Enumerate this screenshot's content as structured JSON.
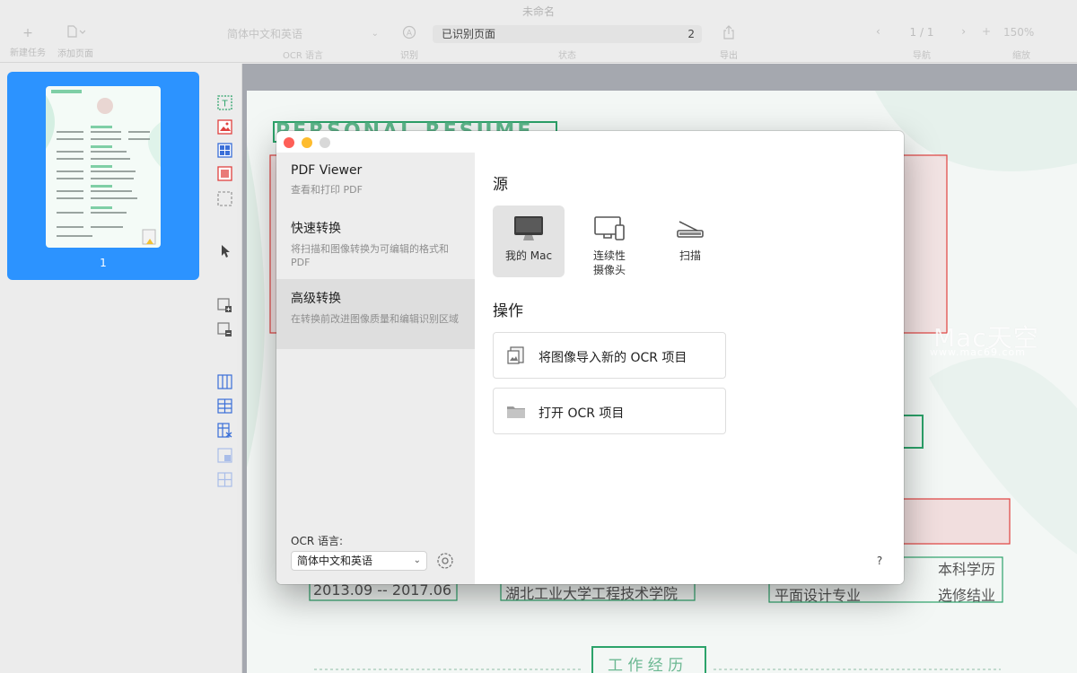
{
  "window": {
    "title": "未命名"
  },
  "toolbar": {
    "new_task": {
      "icon": "plus-icon",
      "label": "新建任务"
    },
    "add_page": {
      "icon": "add-page-icon",
      "label": "添加页面"
    },
    "ocr_language": {
      "value": "简体中文和英语",
      "label": "OCR 语言"
    },
    "recognize": {
      "icon": "recognize-icon",
      "label": "识别"
    },
    "status": {
      "value": "已识别页面",
      "count": "2",
      "label": "状态"
    },
    "export": {
      "icon": "share-icon",
      "label": "导出"
    },
    "navigation": {
      "page": "1 / 1",
      "label": "导航"
    },
    "zoom": {
      "value": "150%",
      "label": "缩放"
    }
  },
  "sidebar": {
    "pages": [
      {
        "number": "1"
      }
    ]
  },
  "tool_strip": {
    "colors": {
      "text": "#2ca36a",
      "image": "#e0413f",
      "table": "#3a6fd8",
      "region": "#9a9a9a"
    }
  },
  "document": {
    "heading": "PERSONAL RESUME",
    "rows": [
      {
        "date": "2013.09 -- 2017.06",
        "school": "湖北工业大学工程技术学院",
        "major": "平面设计专业",
        "degree": "本科学历",
        "note": "选修结业"
      }
    ],
    "section_work": "工 作 经 历"
  },
  "dialog": {
    "menu": [
      {
        "title": "PDF Viewer",
        "desc": "查看和打印 PDF"
      },
      {
        "title": "快速转换",
        "desc": "将扫描和图像转换为可编辑的格式和 PDF"
      },
      {
        "title": "高级转换",
        "desc": "在转换前改进图像质量和编辑识别区域"
      }
    ],
    "ocr_language_label": "OCR 语言:",
    "ocr_language_value": "简体中文和英语",
    "source_title": "源",
    "sources": [
      {
        "label": "我的 Mac",
        "icon": "monitor-icon"
      },
      {
        "label": "连续性\n摄像头",
        "icon": "continuity-camera-icon"
      },
      {
        "label": "扫描",
        "icon": "scanner-icon"
      }
    ],
    "actions_title": "操作",
    "actions": [
      {
        "label": "将图像导入新的 OCR 项目",
        "icon": "import-image-icon"
      },
      {
        "label": "打开 OCR 项目",
        "icon": "folder-icon"
      }
    ],
    "help": "?"
  },
  "watermark": {
    "text": "Mac天空",
    "url": "www.mac69.com"
  }
}
